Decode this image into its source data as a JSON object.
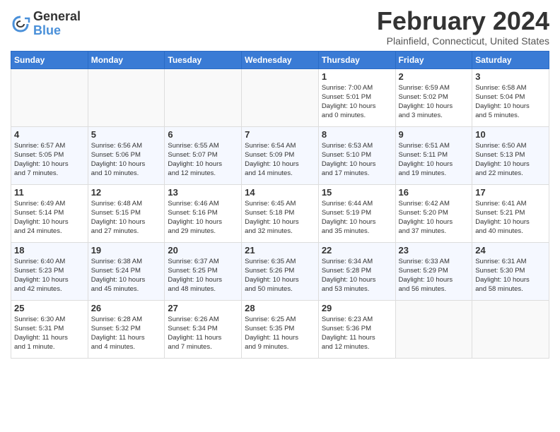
{
  "header": {
    "logo_general": "General",
    "logo_blue": "Blue",
    "title": "February 2024",
    "location": "Plainfield, Connecticut, United States"
  },
  "weekdays": [
    "Sunday",
    "Monday",
    "Tuesday",
    "Wednesday",
    "Thursday",
    "Friday",
    "Saturday"
  ],
  "weeks": [
    [
      {
        "day": "",
        "info": ""
      },
      {
        "day": "",
        "info": ""
      },
      {
        "day": "",
        "info": ""
      },
      {
        "day": "",
        "info": ""
      },
      {
        "day": "1",
        "info": "Sunrise: 7:00 AM\nSunset: 5:01 PM\nDaylight: 10 hours\nand 0 minutes."
      },
      {
        "day": "2",
        "info": "Sunrise: 6:59 AM\nSunset: 5:02 PM\nDaylight: 10 hours\nand 3 minutes."
      },
      {
        "day": "3",
        "info": "Sunrise: 6:58 AM\nSunset: 5:04 PM\nDaylight: 10 hours\nand 5 minutes."
      }
    ],
    [
      {
        "day": "4",
        "info": "Sunrise: 6:57 AM\nSunset: 5:05 PM\nDaylight: 10 hours\nand 7 minutes."
      },
      {
        "day": "5",
        "info": "Sunrise: 6:56 AM\nSunset: 5:06 PM\nDaylight: 10 hours\nand 10 minutes."
      },
      {
        "day": "6",
        "info": "Sunrise: 6:55 AM\nSunset: 5:07 PM\nDaylight: 10 hours\nand 12 minutes."
      },
      {
        "day": "7",
        "info": "Sunrise: 6:54 AM\nSunset: 5:09 PM\nDaylight: 10 hours\nand 14 minutes."
      },
      {
        "day": "8",
        "info": "Sunrise: 6:53 AM\nSunset: 5:10 PM\nDaylight: 10 hours\nand 17 minutes."
      },
      {
        "day": "9",
        "info": "Sunrise: 6:51 AM\nSunset: 5:11 PM\nDaylight: 10 hours\nand 19 minutes."
      },
      {
        "day": "10",
        "info": "Sunrise: 6:50 AM\nSunset: 5:13 PM\nDaylight: 10 hours\nand 22 minutes."
      }
    ],
    [
      {
        "day": "11",
        "info": "Sunrise: 6:49 AM\nSunset: 5:14 PM\nDaylight: 10 hours\nand 24 minutes."
      },
      {
        "day": "12",
        "info": "Sunrise: 6:48 AM\nSunset: 5:15 PM\nDaylight: 10 hours\nand 27 minutes."
      },
      {
        "day": "13",
        "info": "Sunrise: 6:46 AM\nSunset: 5:16 PM\nDaylight: 10 hours\nand 29 minutes."
      },
      {
        "day": "14",
        "info": "Sunrise: 6:45 AM\nSunset: 5:18 PM\nDaylight: 10 hours\nand 32 minutes."
      },
      {
        "day": "15",
        "info": "Sunrise: 6:44 AM\nSunset: 5:19 PM\nDaylight: 10 hours\nand 35 minutes."
      },
      {
        "day": "16",
        "info": "Sunrise: 6:42 AM\nSunset: 5:20 PM\nDaylight: 10 hours\nand 37 minutes."
      },
      {
        "day": "17",
        "info": "Sunrise: 6:41 AM\nSunset: 5:21 PM\nDaylight: 10 hours\nand 40 minutes."
      }
    ],
    [
      {
        "day": "18",
        "info": "Sunrise: 6:40 AM\nSunset: 5:23 PM\nDaylight: 10 hours\nand 42 minutes."
      },
      {
        "day": "19",
        "info": "Sunrise: 6:38 AM\nSunset: 5:24 PM\nDaylight: 10 hours\nand 45 minutes."
      },
      {
        "day": "20",
        "info": "Sunrise: 6:37 AM\nSunset: 5:25 PM\nDaylight: 10 hours\nand 48 minutes."
      },
      {
        "day": "21",
        "info": "Sunrise: 6:35 AM\nSunset: 5:26 PM\nDaylight: 10 hours\nand 50 minutes."
      },
      {
        "day": "22",
        "info": "Sunrise: 6:34 AM\nSunset: 5:28 PM\nDaylight: 10 hours\nand 53 minutes."
      },
      {
        "day": "23",
        "info": "Sunrise: 6:33 AM\nSunset: 5:29 PM\nDaylight: 10 hours\nand 56 minutes."
      },
      {
        "day": "24",
        "info": "Sunrise: 6:31 AM\nSunset: 5:30 PM\nDaylight: 10 hours\nand 58 minutes."
      }
    ],
    [
      {
        "day": "25",
        "info": "Sunrise: 6:30 AM\nSunset: 5:31 PM\nDaylight: 11 hours\nand 1 minute."
      },
      {
        "day": "26",
        "info": "Sunrise: 6:28 AM\nSunset: 5:32 PM\nDaylight: 11 hours\nand 4 minutes."
      },
      {
        "day": "27",
        "info": "Sunrise: 6:26 AM\nSunset: 5:34 PM\nDaylight: 11 hours\nand 7 minutes."
      },
      {
        "day": "28",
        "info": "Sunrise: 6:25 AM\nSunset: 5:35 PM\nDaylight: 11 hours\nand 9 minutes."
      },
      {
        "day": "29",
        "info": "Sunrise: 6:23 AM\nSunset: 5:36 PM\nDaylight: 11 hours\nand 12 minutes."
      },
      {
        "day": "",
        "info": ""
      },
      {
        "day": "",
        "info": ""
      }
    ]
  ]
}
